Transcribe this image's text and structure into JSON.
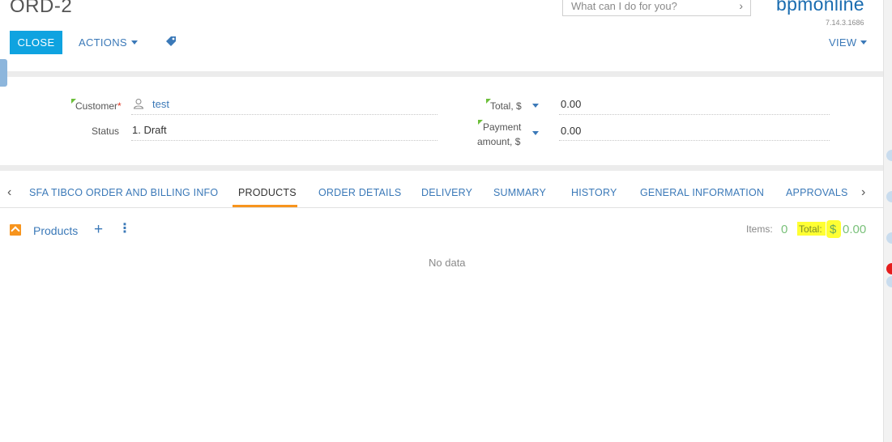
{
  "header": {
    "title": "ORD-2",
    "search_placeholder": "What can I do for you?",
    "logo_text": "bpmonline",
    "version": "7.14.3.1686",
    "close_label": "CLOSE",
    "actions_label": "ACTIONS",
    "view_label": "VIEW"
  },
  "fields": {
    "customer_label": "Customer",
    "customer_required": "*",
    "customer_value": "test",
    "status_label": "Status",
    "status_value": "1. Draft",
    "total_label": "Total, $",
    "total_value": "0.00",
    "payment_label_line1": "Payment",
    "payment_label_line2": "amount, $",
    "payment_value": "0.00"
  },
  "tabs": [
    {
      "label": "SFA TIBCO ORDER AND BILLING INFO",
      "active": false
    },
    {
      "label": "PRODUCTS",
      "active": true
    },
    {
      "label": "ORDER DETAILS",
      "active": false
    },
    {
      "label": "DELIVERY",
      "active": false
    },
    {
      "label": "SUMMARY",
      "active": false
    },
    {
      "label": "HISTORY",
      "active": false
    },
    {
      "label": "GENERAL INFORMATION",
      "active": false
    },
    {
      "label": "APPROVALS",
      "active": false
    }
  ],
  "products": {
    "title": "Products",
    "items_label": "Items:",
    "items_count": "0",
    "total_label": "Total:",
    "total_currency": "$",
    "total_value": "0.00",
    "empty_text": "No data"
  },
  "colors": {
    "accent": "#0fa3e0",
    "link": "#3b79b8",
    "tab_active": "#f7941d",
    "highlight": "#ffff33",
    "required": "#6cbf3a"
  }
}
